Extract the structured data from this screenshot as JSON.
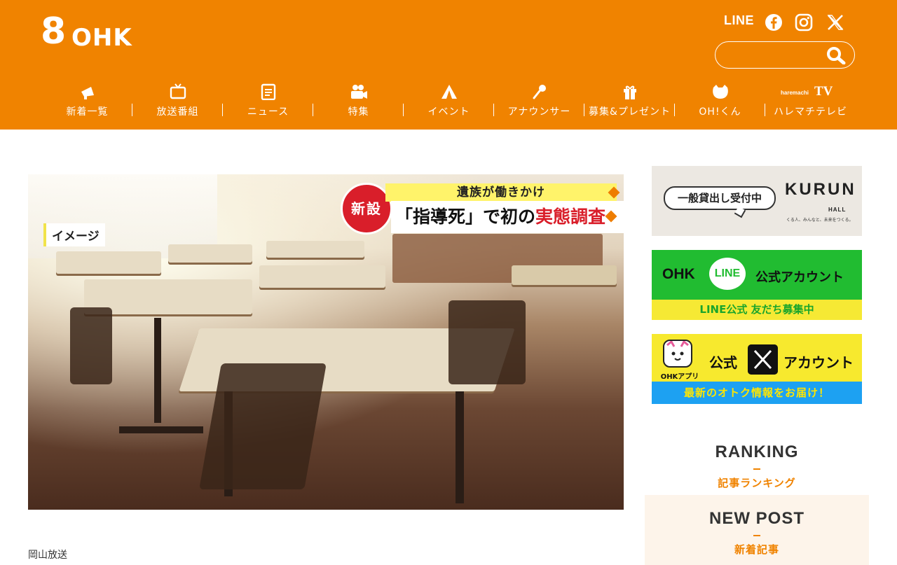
{
  "header": {
    "logo_number": "8",
    "logo_text": "OHK",
    "social_line": "LINE",
    "search_placeholder": ""
  },
  "nav": [
    {
      "label": "新着一覧",
      "icon": "megaphone-icon"
    },
    {
      "label": "放送番組",
      "icon": "tv-icon"
    },
    {
      "label": "ニュース",
      "icon": "notepad-icon"
    },
    {
      "label": "特集",
      "icon": "video-camera-icon"
    },
    {
      "label": "イベント",
      "icon": "tent-icon"
    },
    {
      "label": "アナウンサー",
      "icon": "microphone-icon"
    },
    {
      "label": "募集&プレゼント",
      "icon": "gift-icon"
    },
    {
      "label": "OH!くん",
      "icon": "cat-face-icon"
    },
    {
      "label": "ハレマチテレビ",
      "icon": "haremachi-tv-logo",
      "logo_small": "haremachi",
      "logo_tv": "TV"
    }
  ],
  "hero": {
    "badge": "新設",
    "caption_top": "遺族が働きかけ",
    "caption_main_a": "「指導死」で初の",
    "caption_main_b": "実態調査",
    "image_label": "イメージ"
  },
  "article": {
    "source": "岡山放送"
  },
  "sidebar": {
    "kurun": {
      "bubble": "一般貸出し受付中",
      "logo": "KURUN",
      "hall": "HALL",
      "tagline": "くる人、みんなと、未来をつくる。"
    },
    "line": {
      "ohk": "OHK",
      "line": "LINE",
      "account": "公式アカウント",
      "sub": "LINE公式 友だち募集中"
    },
    "x": {
      "app_label": "OHKアプリ",
      "kou": "公式",
      "account": "アカウント",
      "sub": "最新のオトク情報をお届け！"
    },
    "ranking": {
      "title": "RANKING",
      "sub": "記事ランキング"
    },
    "newpost": {
      "title": "NEW POST",
      "sub": "新着記事"
    }
  },
  "colors": {
    "brand": "#f08300",
    "line_green": "#21bc31",
    "x_yellow": "#f7e92e",
    "x_blue": "#1da1f2"
  }
}
